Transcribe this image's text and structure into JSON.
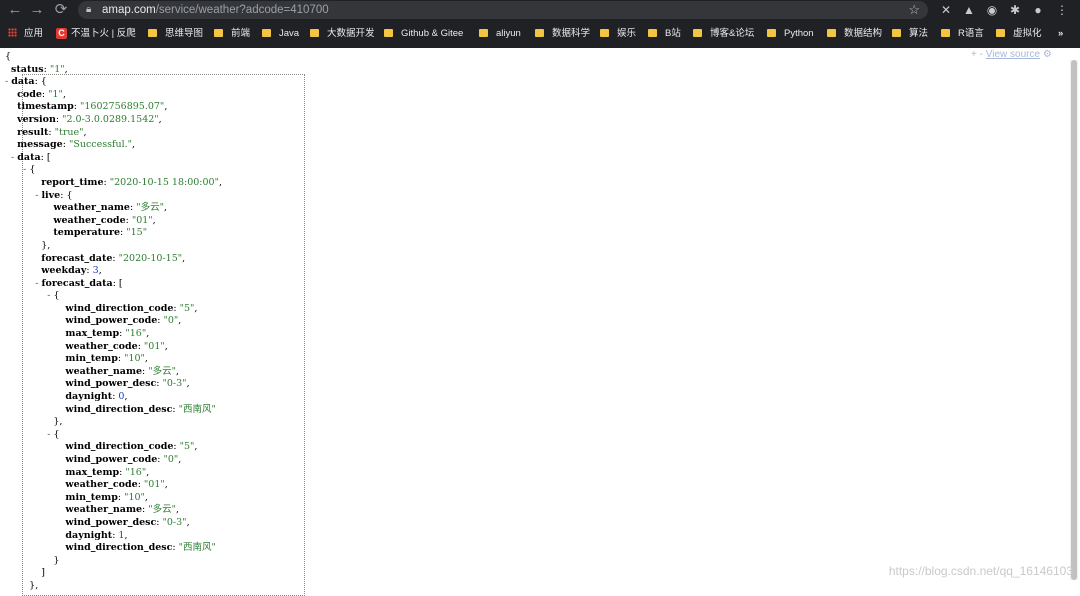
{
  "browser": {
    "url_host": "amap.com",
    "url_path": "/service/weather?adcode=410700",
    "bookmarks": [
      {
        "label": "应用",
        "icon": "apps-grid-icon"
      },
      {
        "label": "不温卜火 | 反爬",
        "icon": "csdn-icon"
      },
      {
        "label": "思维导图",
        "icon": "folder-icon"
      },
      {
        "label": "前端",
        "icon": "folder-icon"
      },
      {
        "label": "Java",
        "icon": "folder-icon"
      },
      {
        "label": "大数据开发",
        "icon": "folder-icon"
      },
      {
        "label": "Github & Gitee",
        "icon": "folder-icon"
      },
      {
        "label": "aliyun",
        "icon": "folder-icon"
      },
      {
        "label": "数据科学",
        "icon": "folder-icon"
      },
      {
        "label": "娱乐",
        "icon": "folder-icon"
      },
      {
        "label": "B站",
        "icon": "folder-icon"
      },
      {
        "label": "博客&论坛",
        "icon": "folder-icon"
      },
      {
        "label": "Python",
        "icon": "folder-icon"
      },
      {
        "label": "数据结构",
        "icon": "folder-icon"
      },
      {
        "label": "算法",
        "icon": "folder-icon"
      },
      {
        "label": "R语言",
        "icon": "folder-icon"
      },
      {
        "label": "虚拟化",
        "icon": "folder-icon"
      }
    ],
    "more_bookmarks": "»"
  },
  "viewer": {
    "view_source_prefix": "+ - ",
    "view_source_label": "View source",
    "watermark": "https://blog.csdn.net/qq_16146103"
  },
  "json_lines": [
    {
      "t": "{"
    },
    {
      "t": "  status: \"1\","
    },
    {
      "t": "- data: {"
    },
    {
      "t": "    code: \"1\","
    },
    {
      "t": "    timestamp: \"1602756895.07\","
    },
    {
      "t": "    version: \"2.0-3.0.0289.1542\","
    },
    {
      "t": "    result: \"true\","
    },
    {
      "t": "    message: \"Successful.\","
    },
    {
      "t": "  - data: ["
    },
    {
      "t": "      - {"
    },
    {
      "t": "            report_time: \"2020-10-15 18:00:00\","
    },
    {
      "t": "          - live: {"
    },
    {
      "t": "                weather_name: \"多云\","
    },
    {
      "t": "                weather_code: \"01\","
    },
    {
      "t": "                temperature: \"15\""
    },
    {
      "t": "            },"
    },
    {
      "t": "            forecast_date: \"2020-10-15\","
    },
    {
      "t": "            weekday: 3,"
    },
    {
      "t": "          - forecast_data: ["
    },
    {
      "t": "              - {"
    },
    {
      "t": "                    wind_direction_code: \"5\","
    },
    {
      "t": "                    wind_power_code: \"0\","
    },
    {
      "t": "                    max_temp: \"16\","
    },
    {
      "t": "                    weather_code: \"01\","
    },
    {
      "t": "                    min_temp: \"10\","
    },
    {
      "t": "                    weather_name: \"多云\","
    },
    {
      "t": "                    wind_power_desc: \"0-3\","
    },
    {
      "t": "                    daynight: 0,"
    },
    {
      "t": "                    wind_direction_desc: \"西南风\""
    },
    {
      "t": "                },"
    },
    {
      "t": "              - {"
    },
    {
      "t": "                    wind_direction_code: \"5\","
    },
    {
      "t": "                    wind_power_code: \"0\","
    },
    {
      "t": "                    max_temp: \"16\","
    },
    {
      "t": "                    weather_code: \"01\","
    },
    {
      "t": "                    min_temp: \"10\","
    },
    {
      "t": "                    weather_name: \"多云\","
    },
    {
      "t": "                    wind_power_desc: \"0-3\","
    },
    {
      "t": "                    daynight: 1,"
    },
    {
      "t": "                    wind_direction_desc: \"西南风\""
    },
    {
      "t": "                }"
    },
    {
      "t": "            ]"
    },
    {
      "t": "        },"
    }
  ]
}
